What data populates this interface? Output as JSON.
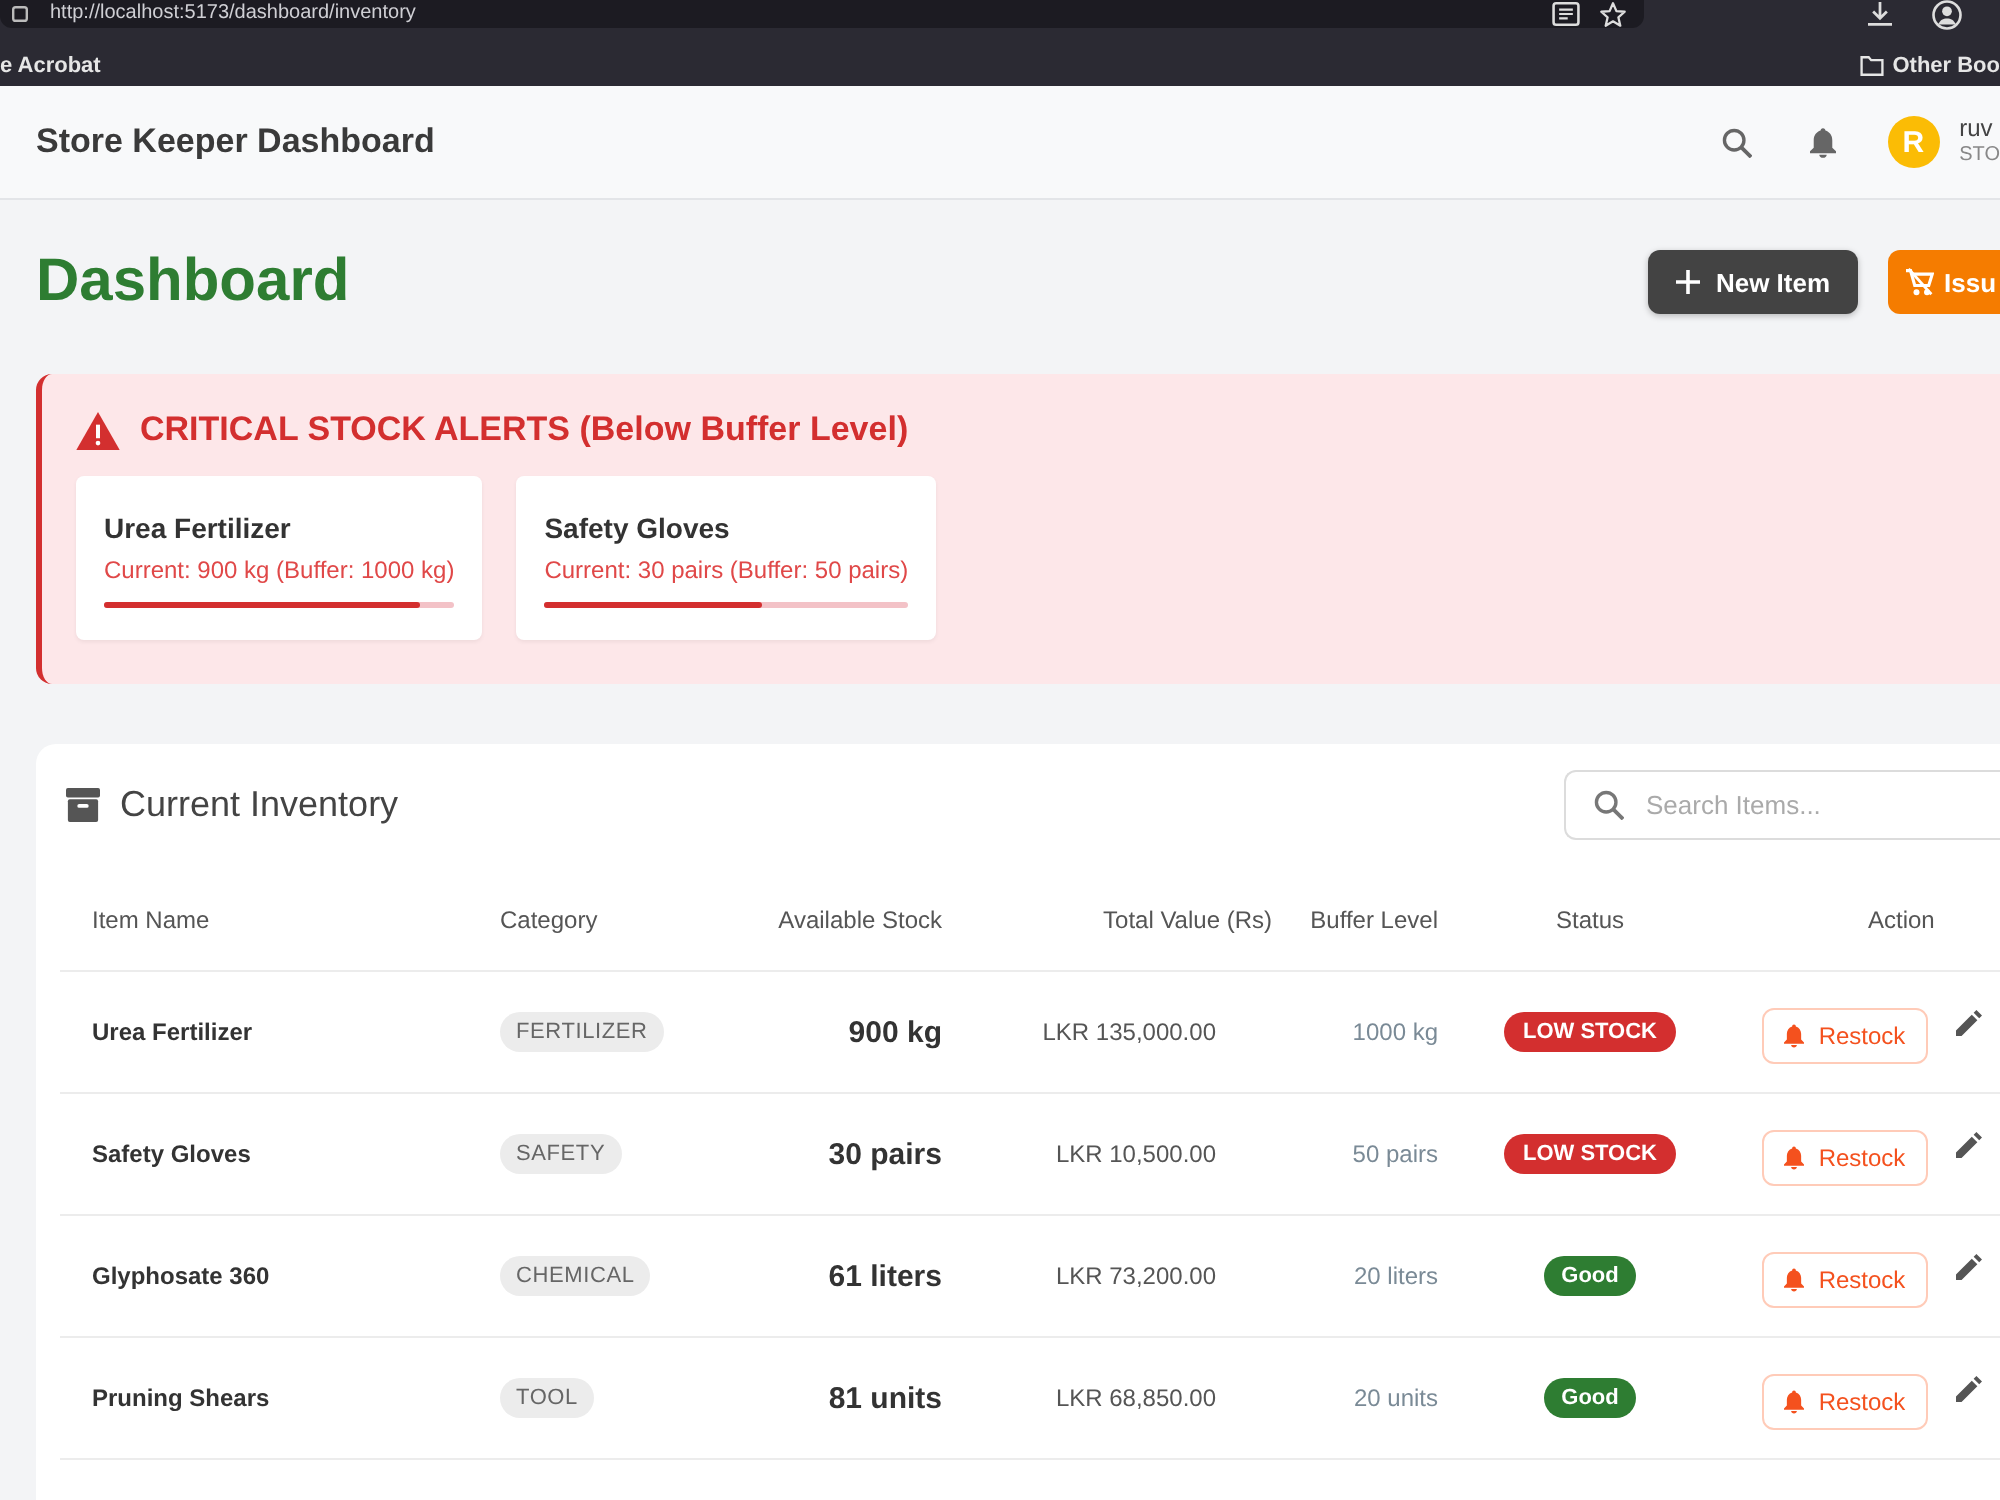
{
  "browser": {
    "url": "http://localhost:5173/dashboard/inventory",
    "bookmarks": [
      {
        "label": "e Acrobat",
        "kind": "link"
      },
      {
        "label": "Other Boo",
        "kind": "folder"
      }
    ]
  },
  "header": {
    "title": "Store Keeper Dashboard",
    "user": {
      "initial": "R",
      "name": "ruv",
      "role": "STO"
    }
  },
  "page": {
    "title": "Dashboard",
    "actions": [
      {
        "label": "New Item",
        "kind": "new"
      },
      {
        "label": "Issu",
        "kind": "issue"
      }
    ]
  },
  "alerts": {
    "title": "CRITICAL STOCK ALERTS (Below Buffer Level)",
    "items": [
      {
        "name": "Urea Fertilizer",
        "detail": "Current: 900 kg (Buffer: 1000 kg)",
        "level": 0.9
      },
      {
        "name": "Safety Gloves",
        "detail": "Current: 30 pairs (Buffer: 50 pairs)",
        "level": 0.6
      }
    ]
  },
  "inventory": {
    "title": "Current Inventory",
    "search": {
      "placeholder": "Search Items..."
    },
    "columns": [
      "Item Name",
      "Category",
      "Available Stock",
      "Total Value (Rs)",
      "Buffer Level",
      "Status",
      "Action"
    ],
    "rows": [
      {
        "name": "Urea Fertilizer",
        "category": "FERTILIZER",
        "stock": "900 kg",
        "value": "LKR 135,000.00",
        "buffer": "1000 kg",
        "status": {
          "label": "LOW STOCK",
          "color": "#d32f2f"
        },
        "action": "Restock"
      },
      {
        "name": "Safety Gloves",
        "category": "SAFETY",
        "stock": "30 pairs",
        "value": "LKR 10,500.00",
        "buffer": "50 pairs",
        "status": {
          "label": "LOW STOCK",
          "color": "#d32f2f"
        },
        "action": "Restock"
      },
      {
        "name": "Glyphosate 360",
        "category": "CHEMICAL",
        "stock": "61 liters",
        "value": "LKR 73,200.00",
        "buffer": "20 liters",
        "status": {
          "label": "Good",
          "color": "#2e7d32"
        },
        "action": "Restock"
      },
      {
        "name": "Pruning Shears",
        "category": "TOOL",
        "stock": "81 units",
        "value": "LKR 68,850.00",
        "buffer": "20 units",
        "status": {
          "label": "Good",
          "color": "#2e7d32"
        },
        "action": "Restock"
      }
    ]
  }
}
